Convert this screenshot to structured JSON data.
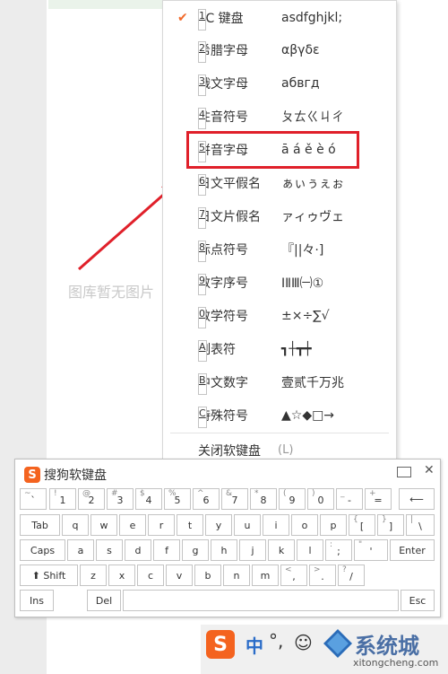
{
  "background": {
    "placeholder_text": "图库暂无图片"
  },
  "menu": {
    "items": [
      {
        "key": "1",
        "label": "PC 键盘",
        "sample": "asdfghjkl;",
        "checked": true
      },
      {
        "key": "2",
        "label": "希腊字母",
        "sample": "αβγδε"
      },
      {
        "key": "3",
        "label": "俄文字母",
        "sample": "абвгд"
      },
      {
        "key": "4",
        "label": "注音符号",
        "sample": "ㄆㄊㄍㄐㄔ"
      },
      {
        "key": "5",
        "label": "拼音字母",
        "sample": "ā á ě è ó"
      },
      {
        "key": "6",
        "label": "日文平假名",
        "sample": "ぁぃぅぇぉ"
      },
      {
        "key": "7",
        "label": "日文片假名",
        "sample": "ァィゥヴェ"
      },
      {
        "key": "8",
        "label": "标点符号",
        "sample": "『||々·]"
      },
      {
        "key": "9",
        "label": "数字序号",
        "sample": "ⅠⅡⅢ㈠①"
      },
      {
        "key": "0",
        "label": "数学符号",
        "sample": "±×÷∑√"
      },
      {
        "key": "A",
        "label": "制表符",
        "sample": "┓┼┳┿"
      },
      {
        "key": "B",
        "label": "中文数字",
        "sample": "壹贰千万兆"
      },
      {
        "key": "C",
        "label": "特殊符号",
        "sample": "▲☆◆□→"
      }
    ],
    "close_label": "关闭软键盘",
    "close_shortcut": "(L)"
  },
  "keyboard": {
    "title": "搜狗软键盘",
    "logo_letter": "S",
    "close_symbol": "✕",
    "rows": [
      [
        {
          "b": "`",
          "t": "~"
        },
        {
          "b": "1",
          "t": "!"
        },
        {
          "b": "2",
          "t": "@"
        },
        {
          "b": "3",
          "t": "#"
        },
        {
          "b": "4",
          "t": "$"
        },
        {
          "b": "5",
          "t": "%"
        },
        {
          "b": "6",
          "t": "^"
        },
        {
          "b": "7",
          "t": "&"
        },
        {
          "b": "8",
          "t": "*"
        },
        {
          "b": "9",
          "t": "("
        },
        {
          "b": "0",
          "t": ")"
        },
        {
          "b": "-",
          "t": "_"
        },
        {
          "b": "=",
          "t": "+"
        },
        {
          "c": "⟵"
        }
      ],
      [
        {
          "c": "Tab"
        },
        {
          "c": "q"
        },
        {
          "c": "w"
        },
        {
          "c": "e"
        },
        {
          "c": "r"
        },
        {
          "c": "t"
        },
        {
          "c": "y"
        },
        {
          "c": "u"
        },
        {
          "c": "i"
        },
        {
          "c": "o"
        },
        {
          "c": "p"
        },
        {
          "b": "[",
          "t": "{"
        },
        {
          "b": "]",
          "t": "}"
        },
        {
          "b": "\\",
          "t": "|"
        }
      ],
      [
        {
          "c": "Caps"
        },
        {
          "c": "a"
        },
        {
          "c": "s"
        },
        {
          "c": "d"
        },
        {
          "c": "f"
        },
        {
          "c": "g"
        },
        {
          "c": "h"
        },
        {
          "c": "j"
        },
        {
          "c": "k"
        },
        {
          "c": "l"
        },
        {
          "b": ";",
          "t": ":"
        },
        {
          "b": "'",
          "t": "\""
        },
        {
          "c": "Enter"
        }
      ],
      [
        {
          "c": "⬆ Shift"
        },
        {
          "c": "z"
        },
        {
          "c": "x"
        },
        {
          "c": "c"
        },
        {
          "c": "v"
        },
        {
          "c": "b"
        },
        {
          "c": "n"
        },
        {
          "c": "m"
        },
        {
          "b": ",",
          "t": "<"
        },
        {
          "b": ".",
          "t": ">"
        },
        {
          "b": "/",
          "t": "?"
        }
      ],
      [
        {
          "c": "Ins"
        },
        {
          "c": "Del"
        },
        {
          "c": ""
        },
        {
          "c": "Esc"
        }
      ]
    ]
  },
  "taskbar": {
    "logo_letter": "S",
    "mode": "中",
    "punctuation": "°,",
    "emoji": "☺"
  },
  "watermark": {
    "brand": "系统城",
    "url": "xitongcheng.com"
  },
  "colors": {
    "accent": "#f4631f",
    "highlight": "#e0202a",
    "arrow": "#e0202a"
  }
}
